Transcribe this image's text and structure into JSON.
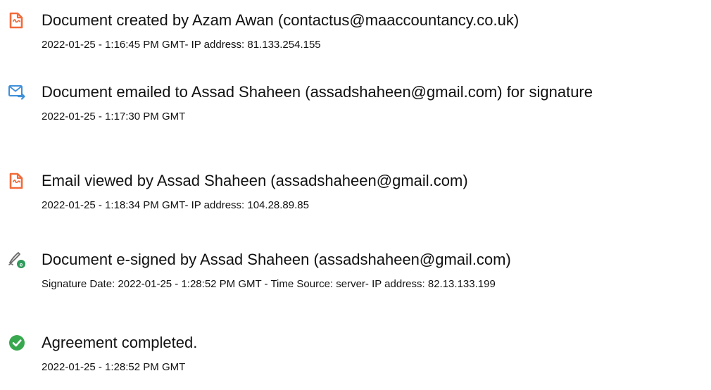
{
  "events": [
    {
      "icon": "document-icon",
      "title": "Document created by Azam Awan (contactus@maaccountancy.co.uk)",
      "detail": "2022-01-25 - 1:16:45 PM GMT- IP address: 81.133.254.155"
    },
    {
      "icon": "email-sent-icon",
      "title": "Document emailed to Assad Shaheen (assadshaheen@gmail.com) for signature",
      "detail": "2022-01-25 - 1:17:30 PM GMT"
    },
    {
      "icon": "document-icon",
      "title": "Email viewed by Assad Shaheen (assadshaheen@gmail.com)",
      "detail": "2022-01-25 - 1:18:34 PM GMT- IP address: 104.28.89.85"
    },
    {
      "icon": "esign-pen-icon",
      "title": "Document e-signed by Assad Shaheen (assadshaheen@gmail.com)",
      "detail": "Signature Date: 2022-01-25 - 1:28:52 PM GMT - Time Source: server- IP address: 82.13.133.199"
    },
    {
      "icon": "check-circle-icon",
      "title": "Agreement completed.",
      "detail": "2022-01-25 - 1:28:52 PM GMT"
    }
  ],
  "colors": {
    "document_icon": "#f26b3a",
    "email_icon": "#3f8fd8",
    "pen_icon": "#6b6b6b",
    "badge_green": "#2e9a5b",
    "check_green": "#38a84f",
    "text": "#111111"
  }
}
